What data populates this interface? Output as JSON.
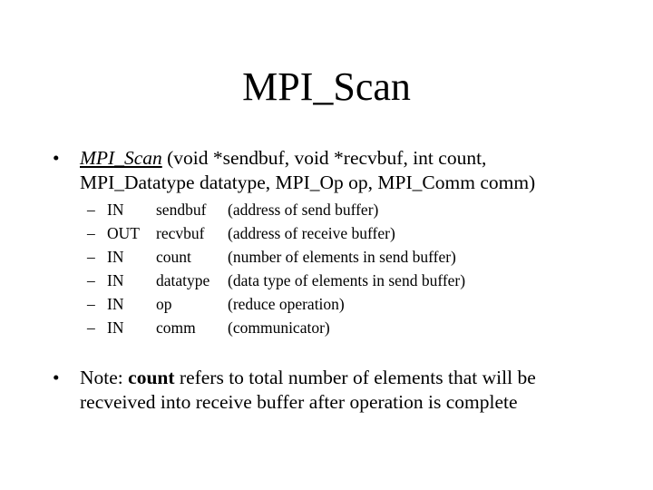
{
  "title": "MPI_Scan",
  "bullet1": {
    "marker": "•",
    "func_name": "MPI_Scan",
    "signature_rest": " (void *sendbuf, void *recvbuf, int count,",
    "signature_line2": "MPI_Datatype datatype, MPI_Op op, MPI_Comm comm)"
  },
  "params": [
    {
      "dash": "–",
      "dir": "IN",
      "name": "sendbuf",
      "desc": "(address of send buffer)"
    },
    {
      "dash": "–",
      "dir": "OUT",
      "name": "recvbuf",
      "desc": "(address of receive buffer)"
    },
    {
      "dash": "–",
      "dir": "IN",
      "name": "count",
      "desc": "(number of elements in send buffer)"
    },
    {
      "dash": "–",
      "dir": "IN",
      "name": "datatype",
      "desc": "(data type of elements in send buffer)"
    },
    {
      "dash": "–",
      "dir": "IN",
      "name": "op",
      "desc": "(reduce operation)"
    },
    {
      "dash": "–",
      "dir": "IN",
      "name": "comm",
      "desc": "(communicator)"
    }
  ],
  "bullet2": {
    "marker": "•",
    "prefix": "Note: ",
    "bold_word": "count",
    "line1_rest": " refers to total number of elements that will be",
    "line2": "recveived into receive buffer after operation is complete"
  }
}
